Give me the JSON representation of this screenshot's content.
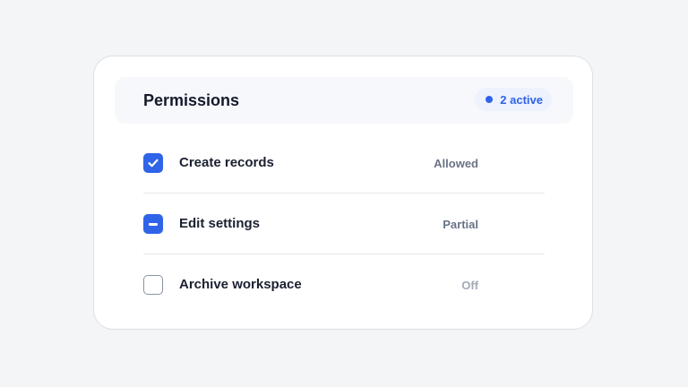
{
  "permissions": {
    "title": "Permissions",
    "badge": {
      "text": "2 active",
      "color": "#2f63e8"
    },
    "items": [
      {
        "label": "Create records",
        "status": "Allowed",
        "state": "checked"
      },
      {
        "label": "Edit settings",
        "status": "Partial",
        "state": "indeterminate"
      },
      {
        "label": "Archive workspace",
        "status": "Off",
        "state": "unchecked"
      }
    ]
  },
  "colors": {
    "accent": "#2f63e8",
    "background": "#f4f5f7"
  }
}
